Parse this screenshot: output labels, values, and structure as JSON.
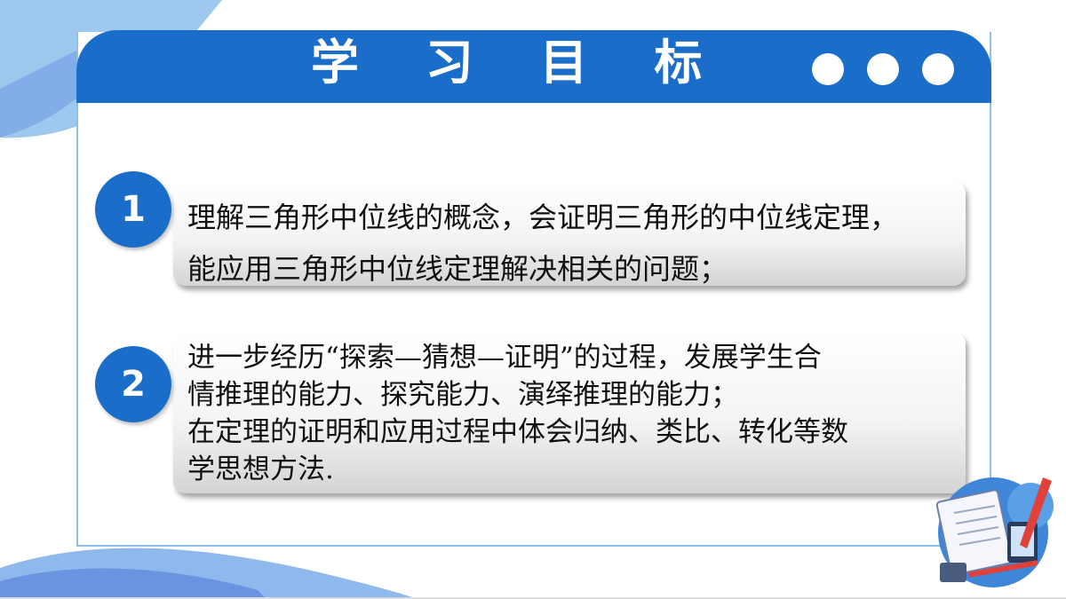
{
  "title": "学 习 目 标",
  "objectives": [
    {
      "number": "1",
      "lines": [
        "理解三角形中位线的概念，会证明三角形的中位线定理，",
        "能应用三角形中位线定理解决相关的问题；"
      ]
    },
    {
      "number": "2",
      "lines": [
        "进一步经历“探索—猜想—证明”的过程，发展学生合",
        "情推理的能力、探究能力、演绎推理的能力；",
        "在定理的证明和应用过程中体会归纳、类比、转化等数",
        "学思想方法."
      ]
    }
  ],
  "colors": {
    "accent": "#1a6dc8",
    "frame": "#8cc0e8",
    "decor_light": "#9fc8ee"
  },
  "icons": [
    "dot-icon",
    "dot-icon",
    "dot-icon",
    "math-notebook-illustration"
  ]
}
